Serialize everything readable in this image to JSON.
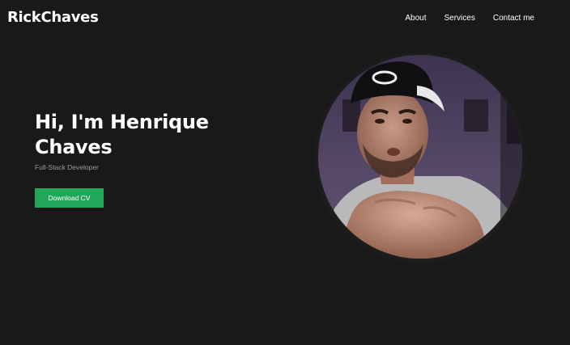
{
  "header": {
    "logo": "RickChaves",
    "nav": [
      {
        "label": "About"
      },
      {
        "label": "Services"
      },
      {
        "label": "Contact me"
      }
    ]
  },
  "hero": {
    "title": "Hi, I'm Henrique Chaves",
    "subtitle": "Full-Stack Developer",
    "cta_label": "Download CV",
    "cta_color": "#22a75a"
  },
  "theme": {
    "background": "#191919",
    "text": "#ffffff",
    "muted_text": "#9a9a9a"
  },
  "profile_photo": {
    "icon": "profile-photo"
  }
}
